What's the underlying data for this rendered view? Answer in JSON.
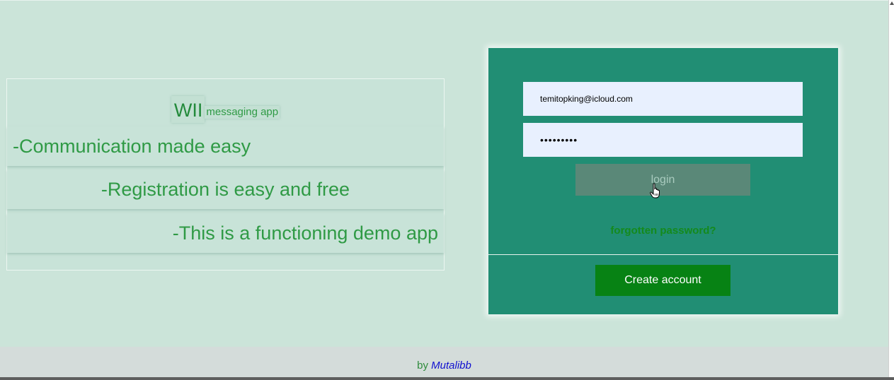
{
  "intro": {
    "brand_name": "WII",
    "brand_sub": "messaging app",
    "features": [
      "-Communication made easy",
      "-Registration is easy and free",
      "-This is a functioning demo app"
    ]
  },
  "login": {
    "email_value": "temitopking@icloud.com",
    "password_value": "•••••••••",
    "login_label": "login",
    "forgot_label": "forgotten password?",
    "create_label": "Create account"
  },
  "footer": {
    "by": "by",
    "author": "Mutalibb"
  },
  "colors": {
    "page_bg": "#cbe4d9",
    "card_bg": "#218e74",
    "create_button": "#078214",
    "login_button": "#5a8878",
    "text_green": "#2f9a45",
    "author_link": "#1010d0"
  },
  "icons": [
    "hand-pointer-icon",
    "scroll-up-arrow-icon"
  ]
}
